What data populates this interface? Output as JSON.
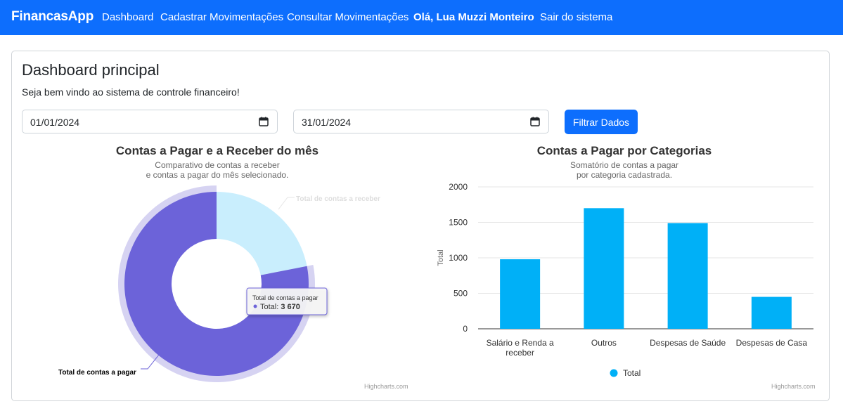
{
  "navbar": {
    "brand": "FinancasApp",
    "links": [
      "Dashboard",
      "Cadastrar Movimentações",
      "Consultar Movimentações"
    ],
    "greeting": "Olá, Lua Muzzi Monteiro",
    "logout": "Sair do sistema"
  },
  "page": {
    "title": "Dashboard principal",
    "subtitle": "Seja bem vindo ao sistema de controle financeiro!"
  },
  "filters": {
    "start_date": "01/01/2024",
    "end_date": "31/01/2024",
    "button_label": "Filtrar Dados"
  },
  "colors": {
    "brand": "#0d6efd",
    "pagar": "#6c63d9",
    "receber": "#c9eefd",
    "bar": "#00b0f7"
  },
  "chart_data": [
    {
      "type": "pie",
      "title": "Contas a Pagar e a Receber do mês",
      "subtitle_lines": [
        "Comparativo de contas a receber",
        "e contas a pagar do mês selecionado."
      ],
      "labels": [
        "Total de contas a receber",
        "Total de contas a pagar"
      ],
      "values": [
        1030,
        3670
      ],
      "tooltip": {
        "header": "Total de contas a pagar",
        "series": "Total",
        "value": "3 670"
      },
      "credits": "Highcharts.com"
    },
    {
      "type": "bar",
      "title": "Contas a Pagar por Categorias",
      "subtitle_lines": [
        "Somatório de contas a pagar",
        "por categoria cadastrada."
      ],
      "categories": [
        "Salário e Renda a receber",
        "Outros",
        "Despesas de Saúde",
        "Despesas de Casa"
      ],
      "series": [
        {
          "name": "Total",
          "values": [
            980,
            1700,
            1490,
            450
          ]
        }
      ],
      "ylabel": "Total",
      "ylim": [
        0,
        2000
      ],
      "yticks": [
        "0",
        "500",
        "1000",
        "1500",
        "2000"
      ],
      "grid": true,
      "legend_position": "bottom",
      "credits": "Highcharts.com"
    }
  ]
}
